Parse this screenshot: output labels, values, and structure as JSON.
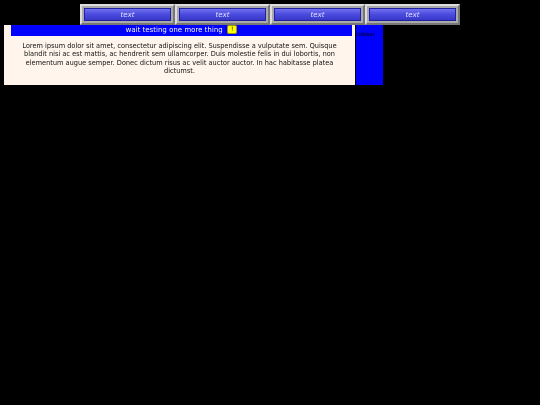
{
  "nav": {
    "buttons": [
      {
        "label": "text"
      },
      {
        "label": "text"
      },
      {
        "label": "text"
      },
      {
        "label": "text"
      }
    ]
  },
  "banner": {
    "text": "wait testing one more thing",
    "badge": "!"
  },
  "main": {
    "paragraph": "Lorem ipsum dolor sit amet, consectetur adipiscing elit. Suspendisse a vulputate sem. Quisque blandit nisi ac est mattis, ac hendrerit sem ullamcorper. Duis molestie felis in dui lobortis, non elementum augue semper. Donec dictum risus ac velit auctor auctor. In hac habitasse platea dictumst."
  },
  "side": {
    "text": "sidebar"
  },
  "colors": {
    "background": "#000000",
    "banner": "#0000ff",
    "content": "#fff5ec",
    "badge": "#ffff00",
    "nav_button": "#4a4adf"
  }
}
